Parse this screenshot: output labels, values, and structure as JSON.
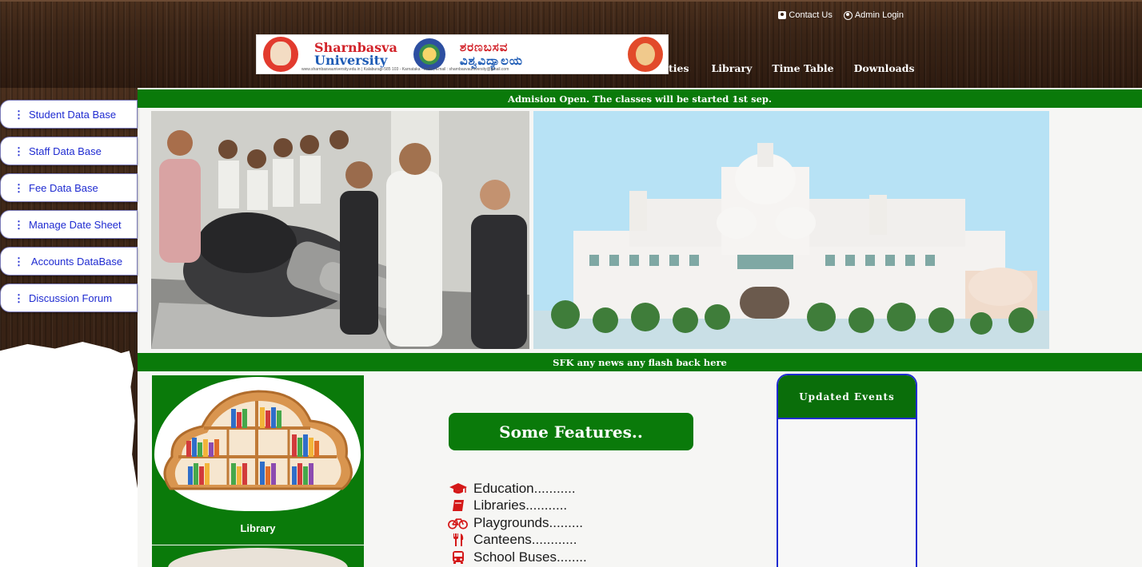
{
  "header": {
    "top_links": [
      {
        "label": "Contact Us",
        "icon": "contact-icon"
      },
      {
        "label": "Admin Login",
        "icon": "user-circle-icon"
      }
    ],
    "logo": {
      "english_line1": "Sharnbasva",
      "english_line2": "University",
      "kannada_line1": "ಶರಣಬಸವ",
      "kannada_line2": "ವಿಶ್ವವಿದ್ಯಾಲಯ",
      "footer_text": "www.sharnbasvauniversity.edu.in | Kalaburagi-585 103 - Karnataka - India | Email : sharnbasvauniversity@gmail.com"
    },
    "nav": {
      "partial_item": "ties",
      "items": [
        "Library",
        "Time Table",
        "Downloads"
      ]
    }
  },
  "sidebar": {
    "items": [
      {
        "label": "Student Data Base"
      },
      {
        "label": "Staff Data Base"
      },
      {
        "label": "Fee Data Base"
      },
      {
        "label": "Manage Date Sheet"
      },
      {
        "label": " Accounts DataBase"
      },
      {
        "label": "Discussion Forum"
      }
    ]
  },
  "banners": {
    "top": "Admision Open. The classes will be started 1st sep.",
    "news": "SFK any news any flash back here"
  },
  "library_card": {
    "caption": "Library"
  },
  "features": {
    "title": "Some Features..",
    "items": [
      {
        "label": "Education...........",
        "icon": "graduation-cap-icon"
      },
      {
        "label": "Libraries...........",
        "icon": "book-icon"
      },
      {
        "label": "Playgrounds.........",
        "icon": "bicycle-icon"
      },
      {
        "label": "Canteens............",
        "icon": "utensils-icon"
      },
      {
        "label": "School Buses........",
        "icon": "bus-icon"
      }
    ]
  },
  "events": {
    "title": "Updated Events"
  },
  "colors": {
    "green": "#0a7a0a",
    "wood": "#3a2416",
    "link_blue": "#1f2bd1",
    "icon_red": "#d41818"
  }
}
